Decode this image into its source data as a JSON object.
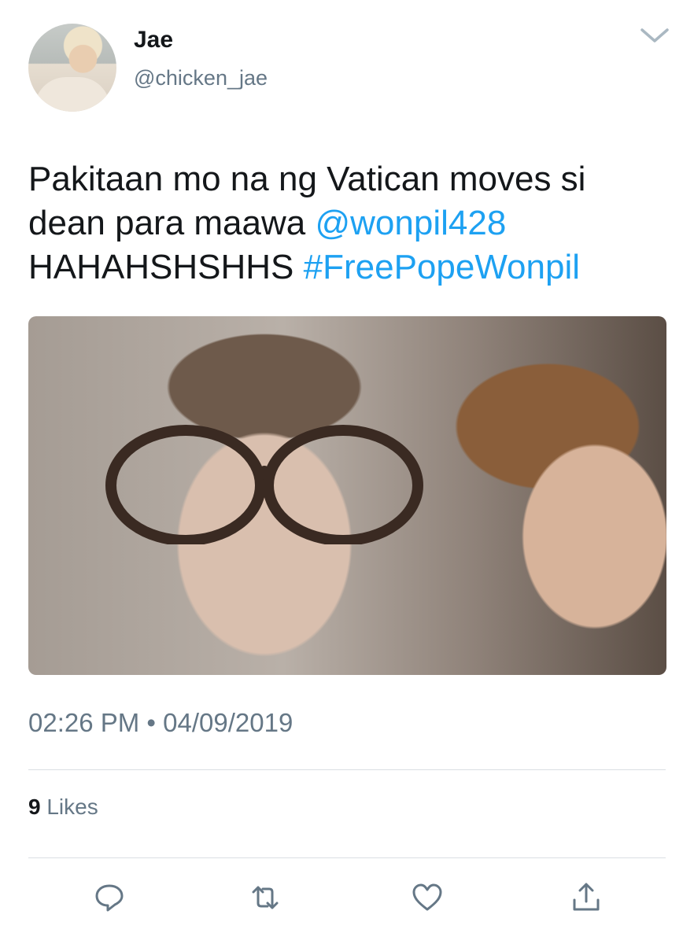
{
  "author": {
    "name": "Jae",
    "handle": "@chicken_jae"
  },
  "tweet": {
    "line1": "Pakitaan mo na ng Vatican moves si",
    "line2_text": "dean para maawa ",
    "mention": "@wonpil428",
    "line3_text": "HAHAHSHSHHS ",
    "hashtag": "#FreePopeWonpil"
  },
  "meta": {
    "timestamp": "02:26 PM • 04/09/2019",
    "likes_count": "9",
    "likes_label": " Likes"
  },
  "icons": {
    "menu": "chevron-down-icon",
    "reply": "reply-icon",
    "retweet": "retweet-icon",
    "like": "heart-icon",
    "share": "share-icon"
  },
  "colors": {
    "link": "#1da1f2",
    "secondary_text": "#657786",
    "primary_text": "#14171a"
  }
}
